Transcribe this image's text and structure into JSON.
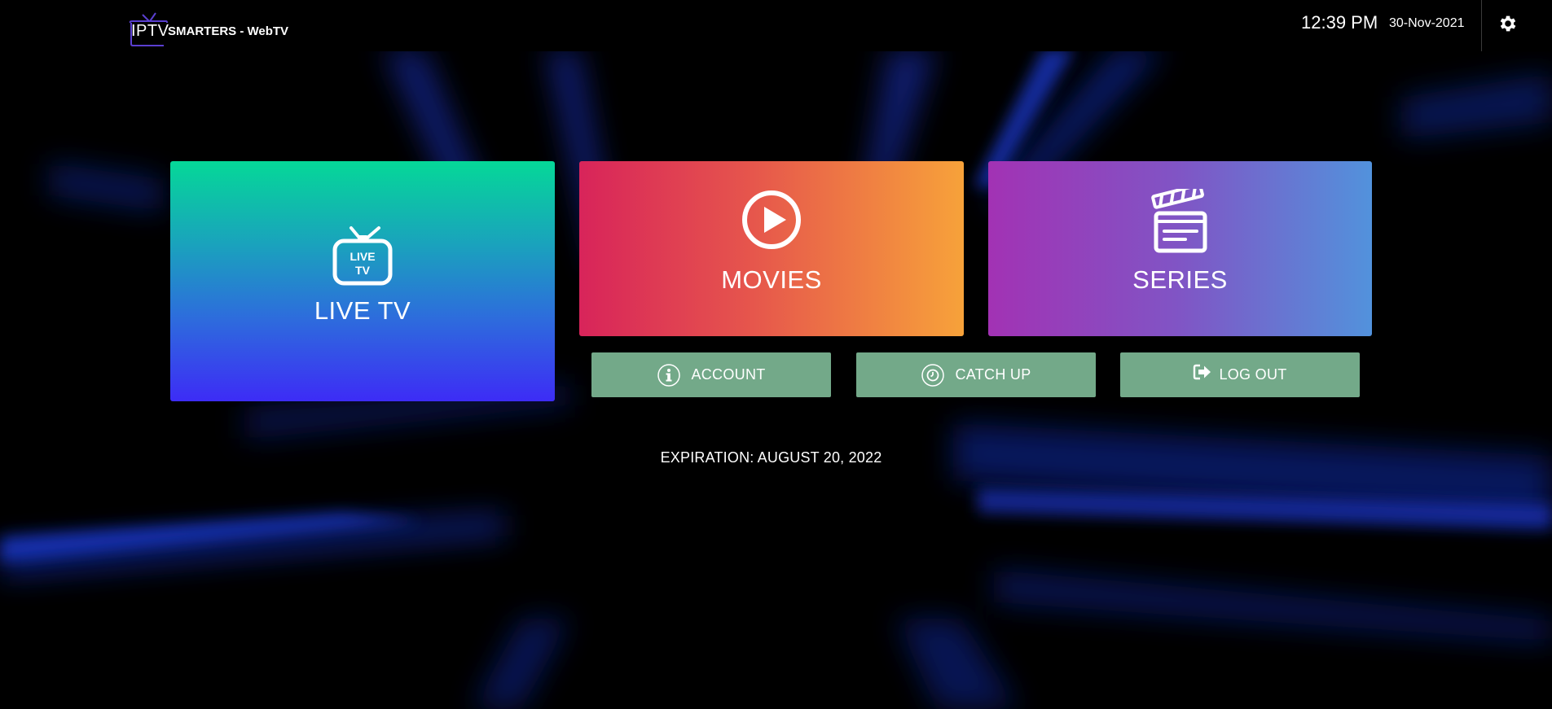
{
  "header": {
    "logo_iptv": "IPTV",
    "logo_brand": "SMARTERS - WebTV",
    "time": "12:39 PM",
    "date": "30-Nov-2021",
    "settings_icon": "gear-icon"
  },
  "tiles": {
    "live_tv": {
      "label": "LIVE TV",
      "icon": "live-tv-icon",
      "icon_text_top": "LIVE",
      "icon_text_bottom": "TV"
    },
    "movies": {
      "label": "MOVIES",
      "icon": "play-icon"
    },
    "series": {
      "label": "SERIES",
      "icon": "clapperboard-icon"
    }
  },
  "buttons": {
    "account": {
      "label": "ACCOUNT",
      "icon": "info-icon"
    },
    "catch_up": {
      "label": "CATCH UP",
      "icon": "clock-icon"
    },
    "log_out": {
      "label": "LOG OUT",
      "icon": "sign-out-icon"
    }
  },
  "expiration": "EXPIRATION: AUGUST 20, 2022",
  "colors": {
    "background": "#000000",
    "button_green": "#73a989",
    "live_top": "#05d898",
    "live_bottom": "#3d2cf6",
    "movies_left": "#d8245a",
    "movies_right": "#f7a23a",
    "series_left": "#a232b4",
    "series_right": "#5292dc"
  }
}
